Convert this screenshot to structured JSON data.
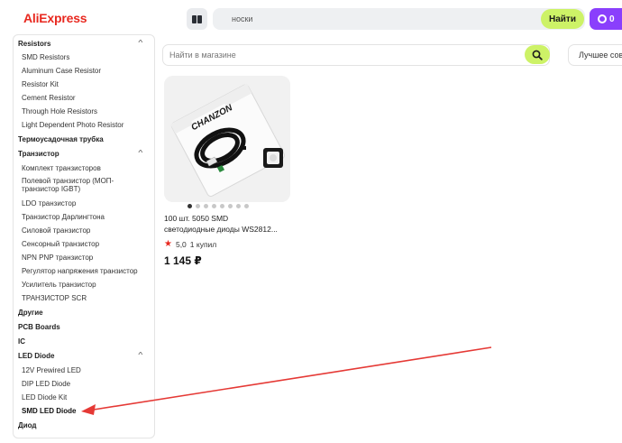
{
  "header": {
    "logo": "AliExpress",
    "search_value": "носки",
    "search_button": "Найти",
    "coins": "0"
  },
  "store": {
    "search_placeholder": "Найти в магазине",
    "sort_label": "Лучшее совп"
  },
  "sidebar": {
    "items": [
      {
        "label": "Resistors",
        "level": "top",
        "expanded": true
      },
      {
        "label": "SMD Resistors",
        "level": "sub"
      },
      {
        "label": "Aluminum Case Resistor",
        "level": "sub"
      },
      {
        "label": "Resistor Kit",
        "level": "sub"
      },
      {
        "label": "Cement Resistor",
        "level": "sub"
      },
      {
        "label": "Through Hole Resistors",
        "level": "sub"
      },
      {
        "label": "Light Dependent Photo Resistor",
        "level": "sub"
      },
      {
        "label": "Термоусадочная трубка",
        "level": "top"
      },
      {
        "label": "Транзистор",
        "level": "top",
        "expanded": true
      },
      {
        "label": "Комплект транзисторов",
        "level": "sub"
      },
      {
        "label": "Полевой транзистор (МОП-",
        "level": "sub"
      },
      {
        "label": "транзистор IGBT)",
        "level": "sub-cont"
      },
      {
        "label": "LDO транзистор",
        "level": "sub"
      },
      {
        "label": "Транзистор Дарлингтона",
        "level": "sub"
      },
      {
        "label": "Силовой транзистор",
        "level": "sub"
      },
      {
        "label": "Сенсорный транзистор",
        "level": "sub"
      },
      {
        "label": "NPN PNP транзистор",
        "level": "sub"
      },
      {
        "label": "Регулятор напряжения транзистор",
        "level": "sub"
      },
      {
        "label": "Усилитель транзистор",
        "level": "sub"
      },
      {
        "label": "ТРАНЗИСТОР SCR",
        "level": "sub"
      },
      {
        "label": "Другие",
        "level": "top"
      },
      {
        "label": "PCB Boards",
        "level": "top"
      },
      {
        "label": "IC",
        "level": "top"
      },
      {
        "label": "LED Diode",
        "level": "top",
        "expanded": true
      },
      {
        "label": "12V Prewired LED",
        "level": "sub"
      },
      {
        "label": "DIP LED Diode",
        "level": "sub"
      },
      {
        "label": "LED Diode Kit",
        "level": "sub"
      },
      {
        "label": "SMD LED Diode",
        "level": "sub",
        "active": true
      },
      {
        "label": "Диод",
        "level": "top"
      }
    ]
  },
  "product": {
    "title_line1": "100 шт. 5050 SMD",
    "title_line2": "светодиодные диоды WS2812...",
    "rating": "5,0",
    "sold": "1 купил",
    "price": "1 145 ₽",
    "image_label": "CHANZON",
    "image_count": 8,
    "active_image": 1
  },
  "colors": {
    "brand": "#e8281f",
    "accent_green": "#cdf267",
    "coins_purple": "#8a3ffc",
    "annotation_arrow": "#e53935"
  }
}
